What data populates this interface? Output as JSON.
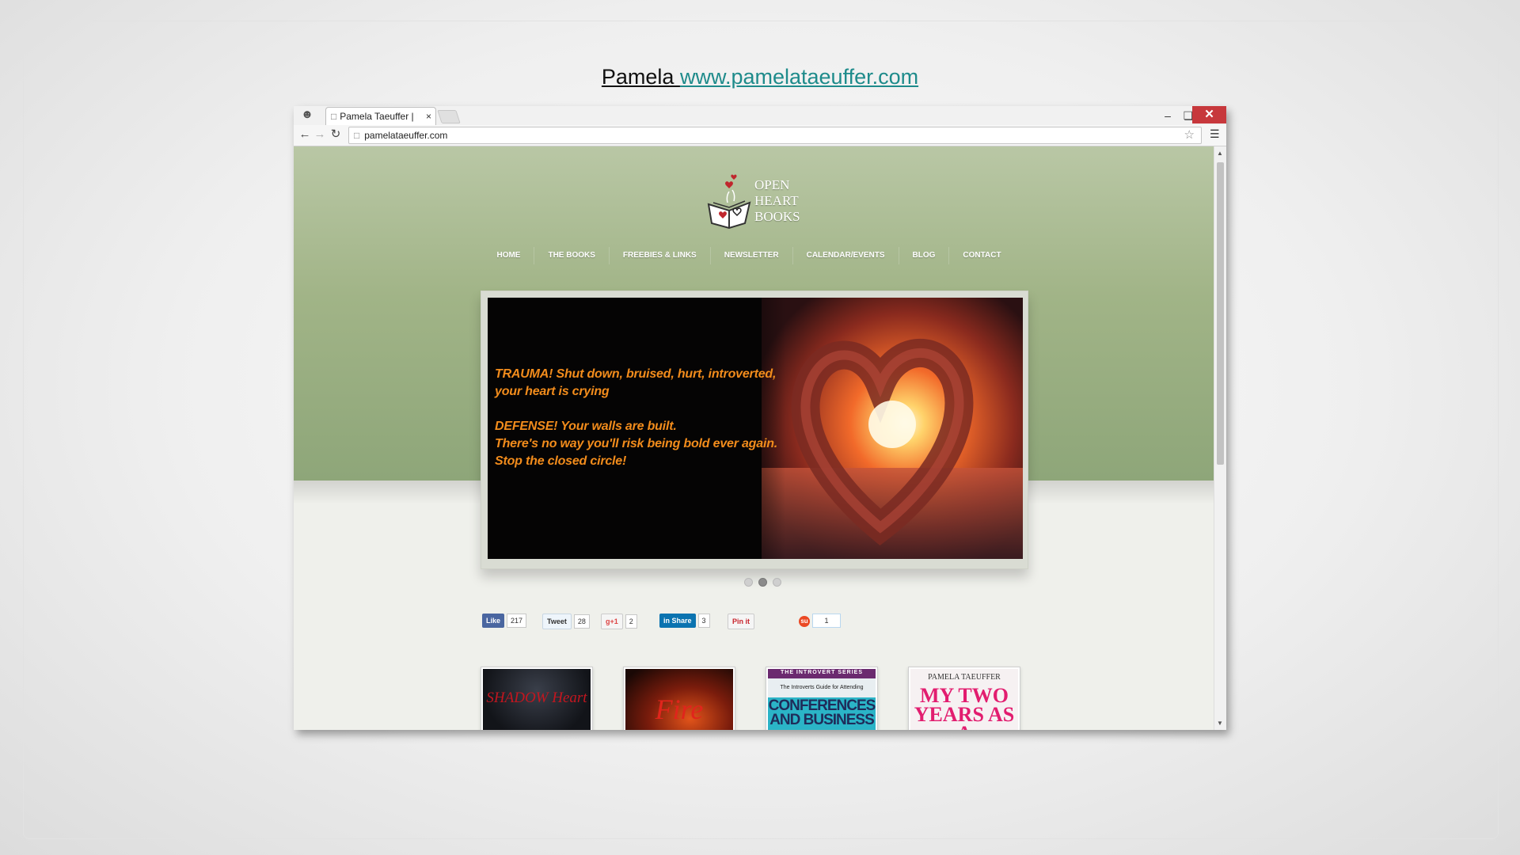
{
  "caption": {
    "name": "Pamela ",
    "link": "www.pamelataeuffer.com"
  },
  "browser": {
    "tab_title": "Pamela Taeuffer | Ro",
    "tab_close": "×",
    "url": "pamelataeuffer.com",
    "window_close": "✕"
  },
  "site": {
    "logo_lines": [
      "OPEN",
      "HEART",
      "BOOKS"
    ],
    "nav": [
      "HOME",
      "THE BOOKS",
      "FREEBIES & LINKS",
      "NEWSLETTER",
      "CALENDAR/EVENTS",
      "BLOG",
      "CONTACT"
    ],
    "slider": {
      "line1": "TRAUMA! Shut down, bruised, hurt, introverted,",
      "line2": "your heart is crying",
      "line3": "DEFENSE! Your walls are built.",
      "line4": "There's no way you'll risk being bold ever again.",
      "line5": "Stop the closed circle!",
      "dots": 3,
      "active_dot": 2
    },
    "social": {
      "facebook": {
        "label": "Like",
        "count": "217"
      },
      "twitter": {
        "label": "Tweet",
        "count": "28"
      },
      "gplus": {
        "label": "g+1",
        "count": "2"
      },
      "linkedin": {
        "label": "in Share",
        "count": "3"
      },
      "pinterest": {
        "label": "Pin it"
      },
      "stumbleupon": {
        "label": "su",
        "count": "1"
      }
    },
    "books": [
      {
        "title": "SHADOW Heart"
      },
      {
        "title": "Fire"
      },
      {
        "series": "THE INTROVERT SERIES",
        "subtitle": "The Introverts Guide for Attending",
        "title": "CONFERENCES AND BUSINESS"
      },
      {
        "author": "PAMELA TAEUFFER",
        "title": "MY TWO YEARS AS A"
      }
    ]
  },
  "colors": {
    "link": "#1e8b8b",
    "hero": "#a1b487",
    "slide_text": "#f28c1c",
    "close": "#c7383c"
  }
}
